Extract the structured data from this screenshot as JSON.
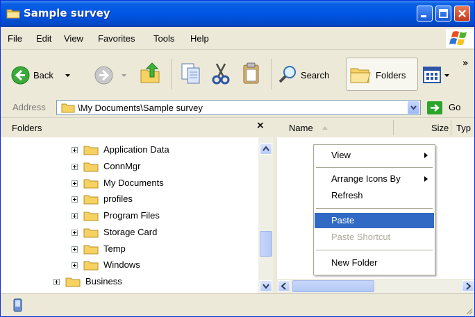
{
  "window": {
    "title": "Sample survey"
  },
  "menubar": [
    "File",
    "Edit",
    "View",
    "Favorites",
    "Tools",
    "Help"
  ],
  "toolbar": {
    "back_label": "Back",
    "search_label": "Search",
    "folders_label": "Folders"
  },
  "address": {
    "label": "Address",
    "value": "\\My Documents\\Sample survey",
    "go_label": "Go"
  },
  "folders_pane": {
    "title": "Folders",
    "close_glyph": "×",
    "items": [
      "Application Data",
      "ConnMgr",
      "My Documents",
      "profiles",
      "Program Files",
      "Storage Card",
      "Temp",
      "Windows",
      "Business"
    ]
  },
  "list_pane": {
    "columns": [
      "Name",
      "Size",
      "Typ"
    ]
  },
  "context_menu": {
    "items": [
      {
        "label": "View",
        "submenu": true,
        "state": "normal"
      },
      {
        "label": "Arrange Icons By",
        "submenu": true,
        "state": "normal"
      },
      {
        "label": "Refresh",
        "submenu": false,
        "state": "normal"
      },
      {
        "label": "Paste",
        "submenu": false,
        "state": "selected"
      },
      {
        "label": "Paste Shortcut",
        "submenu": false,
        "state": "disabled"
      },
      {
        "label": "New Folder",
        "submenu": false,
        "state": "normal"
      }
    ]
  },
  "colors": {
    "titlebar": "#0055e5",
    "selection": "#316ac5",
    "disabled_text": "#aca899",
    "folder": "#f5d262"
  }
}
